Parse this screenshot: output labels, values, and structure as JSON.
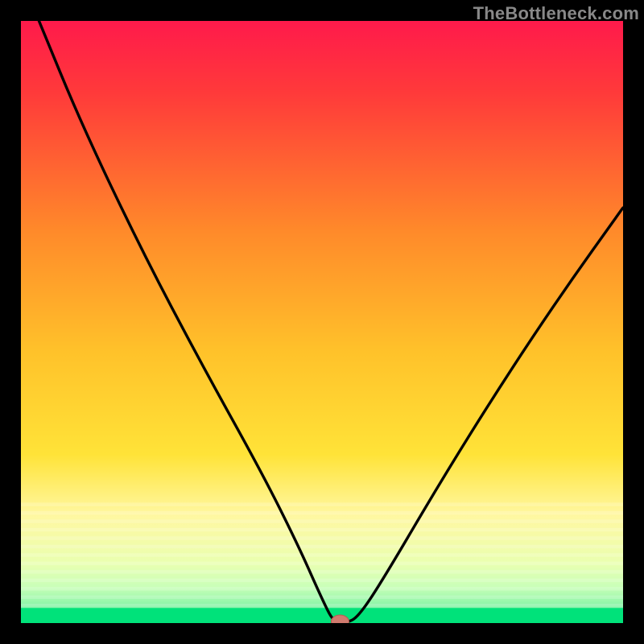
{
  "watermark": "TheBottleneck.com",
  "colors": {
    "gradient_top": "#ff1a4b",
    "gradient_mid": "#ffe338",
    "gradient_green_top": "#e6ff8a",
    "gradient_green": "#00e27a",
    "curve": "#000000",
    "marker_fill": "#d07a6e",
    "marker_stroke": "#b85a50",
    "frame": "#000000"
  },
  "chart_data": {
    "type": "line",
    "title": "",
    "xlabel": "",
    "ylabel": "",
    "xlim": [
      0,
      100
    ],
    "ylim": [
      0,
      100
    ],
    "series": [
      {
        "name": "bottleneck-curve",
        "x": [
          3,
          10,
          20,
          30,
          40,
          46,
          50,
          52,
          54,
          56,
          60,
          70,
          80,
          90,
          100
        ],
        "y": [
          100,
          83,
          62,
          43,
          25,
          13,
          4,
          0,
          0,
          1,
          7,
          24,
          40,
          55,
          69
        ]
      }
    ],
    "marker": {
      "x": 53,
      "y": 0
    },
    "green_band_y_top": 2.5
  }
}
